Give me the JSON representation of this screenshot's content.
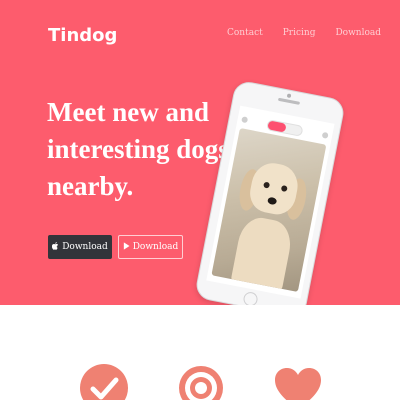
{
  "brand": {
    "name": "Tindog"
  },
  "nav": {
    "items": [
      "Contact",
      "Pricing",
      "Download"
    ]
  },
  "hero": {
    "headline_lines": [
      "Meet new and",
      "interesting dogs",
      "nearby."
    ],
    "download_apple": "Download",
    "download_play": "Download"
  },
  "colors": {
    "hero_bg": "#fd5c6d",
    "dark_button": "#33343a",
    "feature_icon": "#ef8172"
  },
  "icons": {
    "apple": "apple-icon",
    "play": "play-icon",
    "check": "check-circle-icon",
    "target": "target-icon",
    "heart": "heart-icon"
  }
}
